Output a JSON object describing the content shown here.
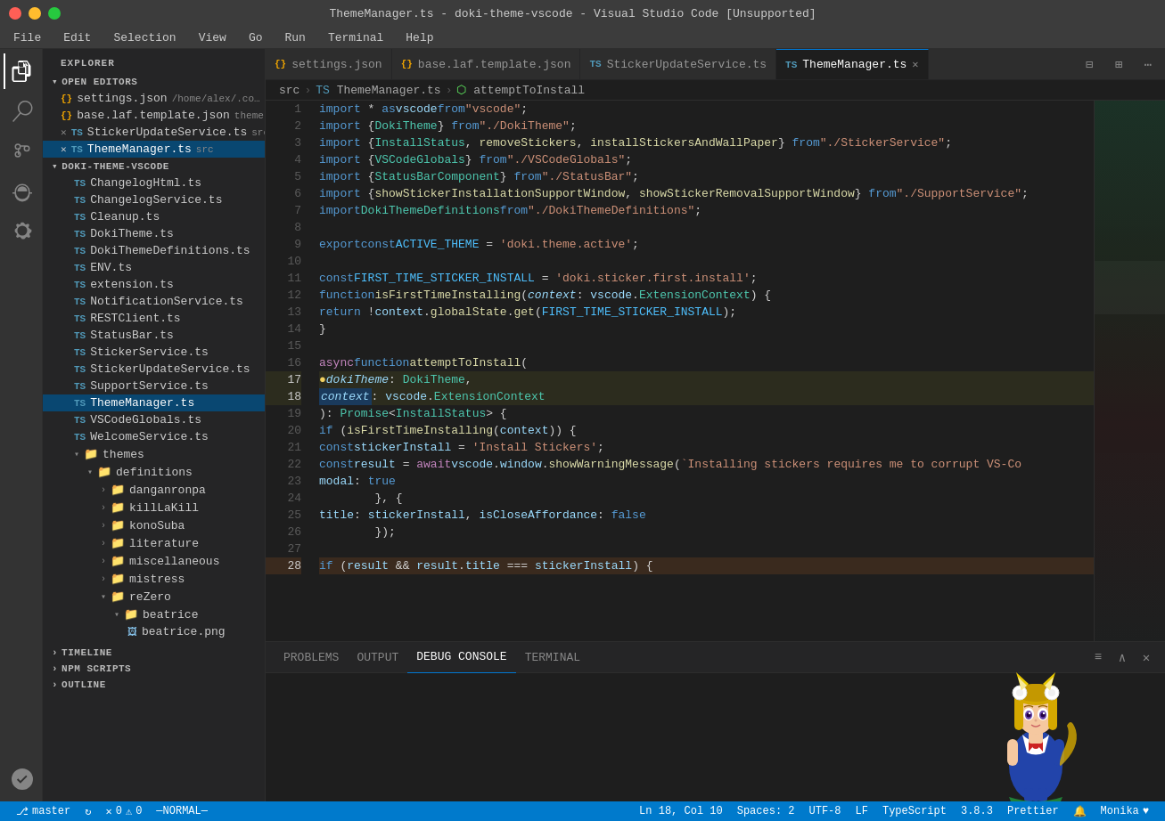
{
  "titleBar": {
    "title": "ThemeManager.ts - doki-theme-vscode - Visual Studio Code [Unsupported]"
  },
  "menuBar": {
    "items": [
      "File",
      "Edit",
      "Selection",
      "View",
      "Go",
      "Run",
      "Terminal",
      "Help"
    ]
  },
  "activityBar": {
    "icons": [
      "explorer",
      "search",
      "source-control",
      "debug",
      "extensions"
    ],
    "bottomIcons": [
      "settings"
    ]
  },
  "sidebar": {
    "header": "EXPLORER",
    "openEditors": {
      "label": "OPEN EDITORS",
      "items": [
        {
          "icon": "json",
          "name": "settings.json",
          "path": "/home/alex/.con...",
          "indent": 1
        },
        {
          "icon": "json",
          "name": "base.laf.template.json",
          "path": "theme...",
          "indent": 1
        },
        {
          "icon": "ts",
          "name": "StickerUpdateService.ts",
          "path": "src",
          "indent": 1
        },
        {
          "icon": "ts",
          "name": "ThemeManager.ts",
          "path": "src",
          "indent": 1,
          "active": true
        }
      ]
    },
    "project": {
      "label": "DOKI-THEME-VSCODE",
      "files": [
        {
          "icon": "ts",
          "name": "ChangelogHtml.ts",
          "indent": 2
        },
        {
          "icon": "ts",
          "name": "ChangelogService.ts",
          "indent": 2
        },
        {
          "icon": "ts",
          "name": "Cleanup.ts",
          "indent": 2
        },
        {
          "icon": "ts",
          "name": "DokiTheme.ts",
          "indent": 2
        },
        {
          "icon": "ts",
          "name": "DokiThemeDefinitions.ts",
          "indent": 2
        },
        {
          "icon": "ts",
          "name": "ENV.ts",
          "indent": 2
        },
        {
          "icon": "ts",
          "name": "extension.ts",
          "indent": 2
        },
        {
          "icon": "ts",
          "name": "NotificationService.ts",
          "indent": 2
        },
        {
          "icon": "ts",
          "name": "RESTClient.ts",
          "indent": 2
        },
        {
          "icon": "ts",
          "name": "StatusBar.ts",
          "indent": 2
        },
        {
          "icon": "ts",
          "name": "StickerService.ts",
          "indent": 2
        },
        {
          "icon": "ts",
          "name": "StickerUpdateService.ts",
          "indent": 2
        },
        {
          "icon": "ts",
          "name": "SupportService.ts",
          "indent": 2
        },
        {
          "icon": "ts",
          "name": "ThemeManager.ts",
          "indent": 2,
          "active": true
        },
        {
          "icon": "ts",
          "name": "VSCodeGlobals.ts",
          "indent": 2
        },
        {
          "icon": "ts",
          "name": "WelcomeService.ts",
          "indent": 2
        }
      ],
      "themes": {
        "label": "themes",
        "indent": 2,
        "definitions": {
          "label": "definitions",
          "indent": 3,
          "subFolders": [
            {
              "name": "danganronpa",
              "indent": 4
            },
            {
              "name": "killLaKill",
              "indent": 4
            },
            {
              "name": "konoSuba",
              "indent": 4
            },
            {
              "name": "literature",
              "indent": 4
            },
            {
              "name": "miscellaneous",
              "indent": 4
            },
            {
              "name": "mistress",
              "indent": 4
            },
            {
              "name": "reZero",
              "indent": 4,
              "expanded": true,
              "children": [
                {
                  "name": "beatrice",
                  "indent": 5,
                  "expanded": true,
                  "children": [
                    {
                      "icon": "png",
                      "name": "beatrice.png",
                      "indent": 6
                    }
                  ]
                }
              ]
            }
          ]
        }
      }
    },
    "timeline": {
      "label": "TIMELINE"
    },
    "npmScripts": {
      "label": "NPM SCRIPTS"
    },
    "outline": {
      "label": "OUTLINE"
    }
  },
  "tabs": [
    {
      "icon": "json",
      "name": "settings.json",
      "active": false
    },
    {
      "icon": "json",
      "name": "base.laf.template.json",
      "active": false
    },
    {
      "icon": "ts",
      "name": "StickerUpdateService.ts",
      "active": false
    },
    {
      "icon": "ts",
      "name": "ThemeManager.ts",
      "active": true,
      "canClose": true
    }
  ],
  "breadcrumb": {
    "parts": [
      "src",
      "TS ThemeManager.ts",
      "attemptToInstall"
    ]
  },
  "editor": {
    "lines": [
      {
        "num": 1,
        "code": "import * as vscode from \"vscode\";"
      },
      {
        "num": 2,
        "code": "import {DokiTheme} from \"./DokiTheme\";"
      },
      {
        "num": 3,
        "code": "import {InstallStatus, removeStickers, installStickersAndWallPaper} from \"./StickerService\";"
      },
      {
        "num": 4,
        "code": "import {VSCodeGlobals} from \"./VSCodeGlobals\";"
      },
      {
        "num": 5,
        "code": "import {StatusBarComponent} from \"./StatusBar\";"
      },
      {
        "num": 6,
        "code": "import {showStickerInstallationSupportWindow, showStickerRemovalSupportWindow} from \"./SupportService\";"
      },
      {
        "num": 7,
        "code": "import DokiThemeDefinitions from \"./DokiThemeDefinitions\";"
      },
      {
        "num": 8,
        "code": ""
      },
      {
        "num": 9,
        "code": "export const ACTIVE_THEME = 'doki.theme.active';"
      },
      {
        "num": 10,
        "code": ""
      },
      {
        "num": 11,
        "code": "const FIRST_TIME_STICKER_INSTALL = 'doki.sticker.first.install';"
      },
      {
        "num": 12,
        "code": "function isFirstTimeInstalling(context: vscode.ExtensionContext) {"
      },
      {
        "num": 13,
        "code": "    return !context.globalState.get(FIRST_TIME_STICKER_INSTALL);"
      },
      {
        "num": 14,
        "code": "}"
      },
      {
        "num": 15,
        "code": ""
      },
      {
        "num": 16,
        "code": "async function attemptToInstall("
      },
      {
        "num": 17,
        "code": "  dokiTheme: DokiTheme,",
        "highlighted": true
      },
      {
        "num": 18,
        "code": "  context: vscode.ExtensionContext",
        "highlighted": true
      },
      {
        "num": 19,
        "code": "): Promise<InstallStatus> {"
      },
      {
        "num": 20,
        "code": "    if (isFirstTimeInstalling(context)) {"
      },
      {
        "num": 21,
        "code": "        const stickerInstall = 'Install Stickers';"
      },
      {
        "num": 22,
        "code": "        const result = await vscode.window.showWarningMessage(`Installing stickers requires me to corrupt VS-Co"
      },
      {
        "num": 23,
        "code": "            modal: true"
      },
      {
        "num": 24,
        "code": "        }, {"
      },
      {
        "num": 25,
        "code": "            title: stickerInstall, isCloseAffordance: false"
      },
      {
        "num": 26,
        "code": "        });"
      },
      {
        "num": 27,
        "code": ""
      },
      {
        "num": 28,
        "code": "        if (result && result.title === stickerInstall) {",
        "highlighted": true
      }
    ]
  },
  "panel": {
    "tabs": [
      "PROBLEMS",
      "OUTPUT",
      "DEBUG CONSOLE",
      "TERMINAL"
    ],
    "activeTab": "DEBUG CONSOLE",
    "content": ""
  },
  "statusBar": {
    "left": [
      {
        "icon": "git",
        "label": "master"
      },
      {
        "icon": "sync",
        "label": ""
      },
      {
        "icon": "error",
        "label": "0"
      },
      {
        "icon": "warning",
        "label": "0"
      },
      {
        "label": "—NORMAL—"
      }
    ],
    "right": [
      {
        "label": "Ln 18, Col 10"
      },
      {
        "label": "Spaces: 2"
      },
      {
        "label": "UTF-8"
      },
      {
        "label": "LF"
      },
      {
        "label": "TypeScript"
      },
      {
        "label": "3.8.3"
      },
      {
        "label": "Prettier"
      },
      {
        "icon": "bell",
        "label": ""
      },
      {
        "label": "Monika"
      },
      {
        "icon": "heart",
        "label": ""
      }
    ]
  }
}
